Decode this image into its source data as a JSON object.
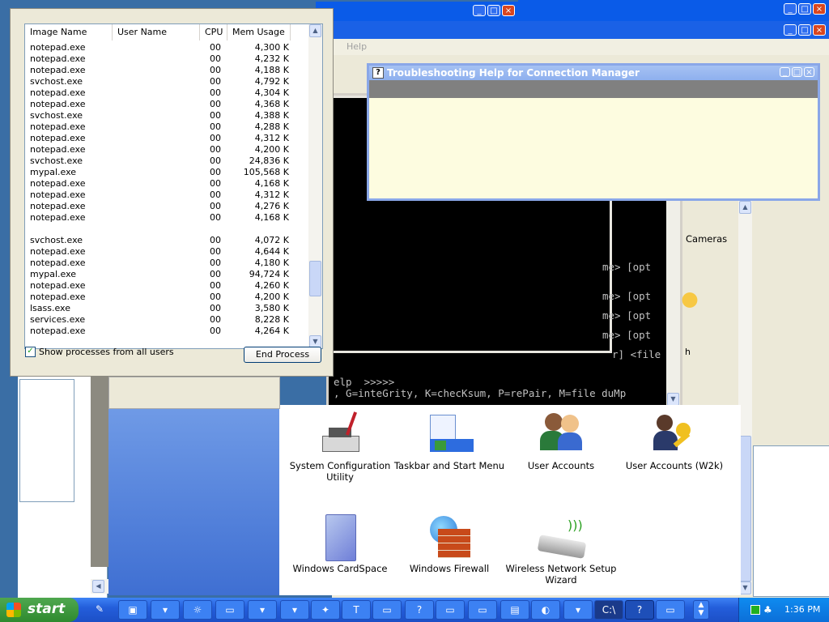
{
  "taskmgr": {
    "columns": [
      "Image Name",
      "User Name",
      "CPU",
      "Mem Usage"
    ],
    "rows": [
      [
        "notepad.exe",
        "00",
        "4,300 K"
      ],
      [
        "notepad.exe",
        "00",
        "4,232 K"
      ],
      [
        "notepad.exe",
        "00",
        "4,188 K"
      ],
      [
        "svchost.exe",
        "00",
        "4,792 K"
      ],
      [
        "notepad.exe",
        "00",
        "4,304 K"
      ],
      [
        "notepad.exe",
        "00",
        "4,368 K"
      ],
      [
        "svchost.exe",
        "00",
        "4,388 K"
      ],
      [
        "notepad.exe",
        "00",
        "4,288 K"
      ],
      [
        "notepad.exe",
        "00",
        "4,312 K"
      ],
      [
        "notepad.exe",
        "00",
        "4,200 K"
      ],
      [
        "svchost.exe",
        "00",
        "24,836 K"
      ],
      [
        "mypal.exe",
        "00",
        "105,568 K"
      ],
      [
        "notepad.exe",
        "00",
        "4,168 K"
      ],
      [
        "notepad.exe",
        "00",
        "4,312 K"
      ],
      [
        "notepad.exe",
        "00",
        "4,276 K"
      ],
      [
        "notepad.exe",
        "00",
        "4,168 K"
      ],
      [
        "",
        "",
        ""
      ],
      [
        "svchost.exe",
        "00",
        "4,072 K"
      ],
      [
        "notepad.exe",
        "00",
        "4,644 K"
      ],
      [
        "notepad.exe",
        "00",
        "4,180 K"
      ],
      [
        "mypal.exe",
        "00",
        "94,724 K"
      ],
      [
        "notepad.exe",
        "00",
        "4,260 K"
      ],
      [
        "notepad.exe",
        "00",
        "4,200 K"
      ],
      [
        "lsass.exe",
        "00",
        "3,580 K"
      ],
      [
        "services.exe",
        "00",
        "8,228 K"
      ],
      [
        "notepad.exe",
        "00",
        "4,264 K"
      ]
    ],
    "show_all_label": "Show processes from all users",
    "show_all_checked": true,
    "end_process_label": "End Process"
  },
  "helpwin": {
    "title": "Troubleshooting Help for Connection Manager"
  },
  "menu_help": "Help",
  "console": {
    "lines": [
      "me> [opt",
      "me> [opt",
      "me> [opt",
      "me> [opt",
      "r] <file",
      "elp  >>>>>",
      ", G=inteGrity, K=checKsum, P=rePair, M=file duMp"
    ],
    "side_text": "h"
  },
  "cpanel": {
    "cameras_label": "Cameras",
    "items": [
      {
        "label": "System Configuration Utility",
        "icon": "system-config-icon"
      },
      {
        "label": "Taskbar and Start Menu",
        "icon": "taskbar-icon"
      },
      {
        "label": "User Accounts",
        "icon": "user-accounts-icon"
      },
      {
        "label": "User Accounts (W2k)",
        "icon": "user-accounts-w2k-icon"
      },
      {
        "label": "Windows CardSpace",
        "icon": "cardspace-icon"
      },
      {
        "label": "Windows Firewall",
        "icon": "firewall-icon"
      },
      {
        "label": "Wireless Network Setup Wizard",
        "icon": "wireless-icon"
      }
    ]
  },
  "taskbar": {
    "start_label": "start",
    "clock": "1:36 PM"
  }
}
